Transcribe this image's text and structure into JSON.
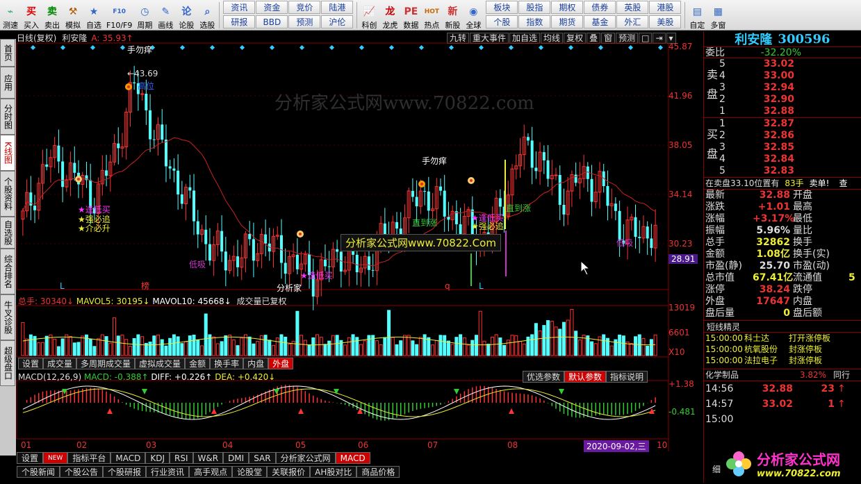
{
  "toolbar": {
    "buttons": [
      {
        "label": "测速",
        "icon": "network-icon",
        "ic": "⌁",
        "color": "#3a6"
      },
      {
        "label": "买入",
        "icon": "buy-icon",
        "ic": "买",
        "color": "#d00"
      },
      {
        "label": "卖出",
        "icon": "sell-icon",
        "ic": "卖",
        "color": "#080"
      },
      {
        "label": "模拟",
        "icon": "hammer-icon",
        "ic": "⚒",
        "color": "#a50"
      },
      {
        "label": "自选",
        "icon": "star-icon",
        "ic": "★",
        "color": "#36c"
      },
      {
        "label": "F10/F9",
        "icon": "f10-icon",
        "ic": "F10",
        "color": "#36c"
      },
      {
        "label": "周期",
        "icon": "clock-icon",
        "ic": "◷",
        "color": "#36c"
      },
      {
        "label": "画线",
        "icon": "pen-icon",
        "ic": "✎",
        "color": "#36c"
      },
      {
        "label": "论股",
        "icon": "forum-icon",
        "ic": "论",
        "color": "#36c"
      },
      {
        "label": "选股",
        "icon": "magnifier-icon",
        "ic": "⌕",
        "color": "#36c"
      }
    ],
    "grid1": [
      "资讯",
      "研报",
      "资金",
      "BBD",
      "竞价",
      "预测",
      "陆港",
      "沪伦"
    ],
    "buttons2": [
      {
        "label": "科创",
        "icon": "chart-icon",
        "ic": "📈",
        "color": "#a33"
      },
      {
        "label": "龙虎",
        "icon": "dragon-icon",
        "ic": "龙",
        "color": "#c00"
      },
      {
        "label": "数据",
        "icon": "pe-icon",
        "ic": "PE",
        "color": "#c33"
      },
      {
        "label": "热点",
        "icon": "hot-icon",
        "ic": "HOT",
        "color": "#c60"
      },
      {
        "label": "新股",
        "icon": "newstock-icon",
        "ic": "新",
        "color": "#c33"
      },
      {
        "label": "全球",
        "icon": "globe-icon",
        "ic": "◉",
        "color": "#36c"
      }
    ],
    "grid2": [
      "板块",
      "个股",
      "股指",
      "指数",
      "期权",
      "期货",
      "债券",
      "基金",
      "英股",
      "外汇",
      "港股",
      "美股"
    ],
    "buttons3": [
      {
        "label": "自定",
        "icon": "custom-icon",
        "ic": "▤",
        "color": "#36c"
      },
      {
        "label": "多窗",
        "icon": "multiwindow-icon",
        "ic": "▦",
        "color": "#36c"
      }
    ]
  },
  "sidebar": [
    "首页",
    "应用",
    "分时图",
    "K线图",
    "个股资料",
    "自选股",
    "综合排名",
    "牛叉诊股",
    "超级盘口"
  ],
  "chart_header": {
    "type": "日线(复权)",
    "name": "利安隆",
    "price_label": "A: 35.93↑"
  },
  "chart_buttons": [
    "九转",
    "重大事件",
    "加自选",
    "均线",
    "复权",
    "叠",
    "窗",
    "预测"
  ],
  "price_axis": [
    "45.87",
    "41.96",
    "38.05",
    "34.14",
    "30.23",
    "28.91"
  ],
  "annotations": {
    "high": "←43.69",
    "signal1": "高位",
    "signal2": "手勿痒",
    "signal3": "手勿痒",
    "buy1": "★逢低买",
    "buy2": "★强必追",
    "buy3": "★介必升",
    "low1": "低吸",
    "low2": "低吸",
    "direct1": "直到涨",
    "direct2": "直到涨",
    "buy4": "★逢低买",
    "buy5": "★强必追",
    "rank": "榜",
    "bottom": "分析家",
    "L1": "L",
    "L2": "L",
    "q": "q"
  },
  "watermark1": "分析家公式网www.70822.com",
  "watermark2": "分析家公式网www.70822.Com",
  "volume": {
    "title": "总手: 30340↓",
    "mavol5": "MAVOL5: 30195↓",
    "mavol10": "MAVOL10: 45668↓",
    "note": "成交量已复权",
    "axis": [
      "13019",
      "6601",
      "X10"
    ]
  },
  "vol_tabs": [
    "设置",
    "成交量",
    "多周期成交量",
    "虚拟成交量",
    "金额",
    "换手率",
    "内盘",
    "外盘"
  ],
  "macd": {
    "title": "MACD(12,26,9)",
    "macd": "MACD: -0.388↑",
    "diff": "DIFF: +0.226↑",
    "dea": "DEA: +0.420↓",
    "axis": [
      "+1.38",
      "-0.481"
    ],
    "btns": [
      "优选参数",
      "默认参数",
      "指标说明"
    ]
  },
  "x_axis": [
    "01",
    "02",
    "03",
    "04",
    "05",
    "06",
    "07",
    "08",
    "10"
  ],
  "date_badge": "2020-09-02,三",
  "bottom_tabs": [
    "设置",
    "NEW",
    "指标平台",
    "MACD",
    "KDJ",
    "RSI",
    "W&R",
    "DMI",
    "SAR",
    "分析家公式网",
    "MACD"
  ],
  "bottom_tabs2": [
    "个股新闻",
    "个股公告",
    "个股研报",
    "行业资讯",
    "高手观点",
    "论股堂",
    "关联报价",
    "AH股对比",
    "商品价格"
  ],
  "quote": {
    "name": "利安隆",
    "code": "300596",
    "webi_label": "委比",
    "webi": "-32.20%",
    "sell_label": "卖盘",
    "buy_label": "买盘",
    "sells": [
      {
        "lvl": "5",
        "p": "33.02"
      },
      {
        "lvl": "4",
        "p": "33.00"
      },
      {
        "lvl": "3",
        "p": "32.94"
      },
      {
        "lvl": "2",
        "p": "32.90"
      },
      {
        "lvl": "1",
        "p": "32.88"
      }
    ],
    "buys": [
      {
        "lvl": "1",
        "p": "32.87"
      },
      {
        "lvl": "2",
        "p": "32.86"
      },
      {
        "lvl": "3",
        "p": "32.85"
      },
      {
        "lvl": "4",
        "p": "32.84"
      },
      {
        "lvl": "5",
        "p": "32.83"
      }
    ],
    "pos": "在卖盘33.10位置有",
    "pos_vol": "83手",
    "pos_tag": "卖单!",
    "pos_extra": "查",
    "stats": [
      {
        "k": "最新",
        "v": "32.88",
        "k2": "开盘",
        "c": "#e33"
      },
      {
        "k": "涨跌",
        "v": "+1.01",
        "k2": "最高",
        "c": "#e33"
      },
      {
        "k": "涨幅",
        "v": "+3.17%",
        "k2": "最低",
        "c": "#e33"
      },
      {
        "k": "振幅",
        "v": "5.96%",
        "k2": "量比",
        "c": "#ddd"
      },
      {
        "k": "总手",
        "v": "32862",
        "k2": "换手",
        "c": "#ee3"
      },
      {
        "k": "金额",
        "v": "1.08亿",
        "k2": "换手(实)",
        "c": "#ee3"
      },
      {
        "k": "市盈(静)",
        "v": "25.70",
        "k2": "市盈(动)",
        "c": "#ddd"
      },
      {
        "k": "总市值",
        "v": "67.41亿",
        "k2": "流通值",
        "c": "#ee3"
      },
      {
        "k": "涨停",
        "v": "38.24",
        "k2": "跌停",
        "c": "#e33"
      },
      {
        "k": "外盘",
        "v": "17647",
        "k2": "内盘",
        "c": "#e33"
      },
      {
        "k": "盘后量",
        "v": "0",
        "k2": "盘后额",
        "c": "#ee3"
      }
    ],
    "liutong_partial": "5",
    "sprite_title": "短线精灵",
    "sprites": [
      {
        "t": "15:00:00",
        "n": "科士达",
        "e": "打开涨停板"
      },
      {
        "t": "15:00:00",
        "n": "杭氧股份",
        "e": "封涨停板"
      },
      {
        "t": "15:00:00",
        "n": "法拉电子",
        "e": "封涨停板"
      }
    ],
    "sector": "化学制品",
    "sector_pct": "3.82%",
    "sector_tab": "同行",
    "ticks": [
      {
        "t": "14:56",
        "p": "32.88",
        "v": "23",
        "a": "↑"
      },
      {
        "t": "14:57",
        "p": "33.02",
        "v": "1",
        "a": "↑"
      },
      {
        "t": "15:00",
        "p": "",
        "v": "",
        "a": ""
      }
    ],
    "logo": "分析家公式网",
    "logo_url": "www.70822.com",
    "logo_partial": "细"
  },
  "colors": {
    "up": "#ff3333",
    "down": "#54ffff",
    "ma": "#cc2222"
  }
}
